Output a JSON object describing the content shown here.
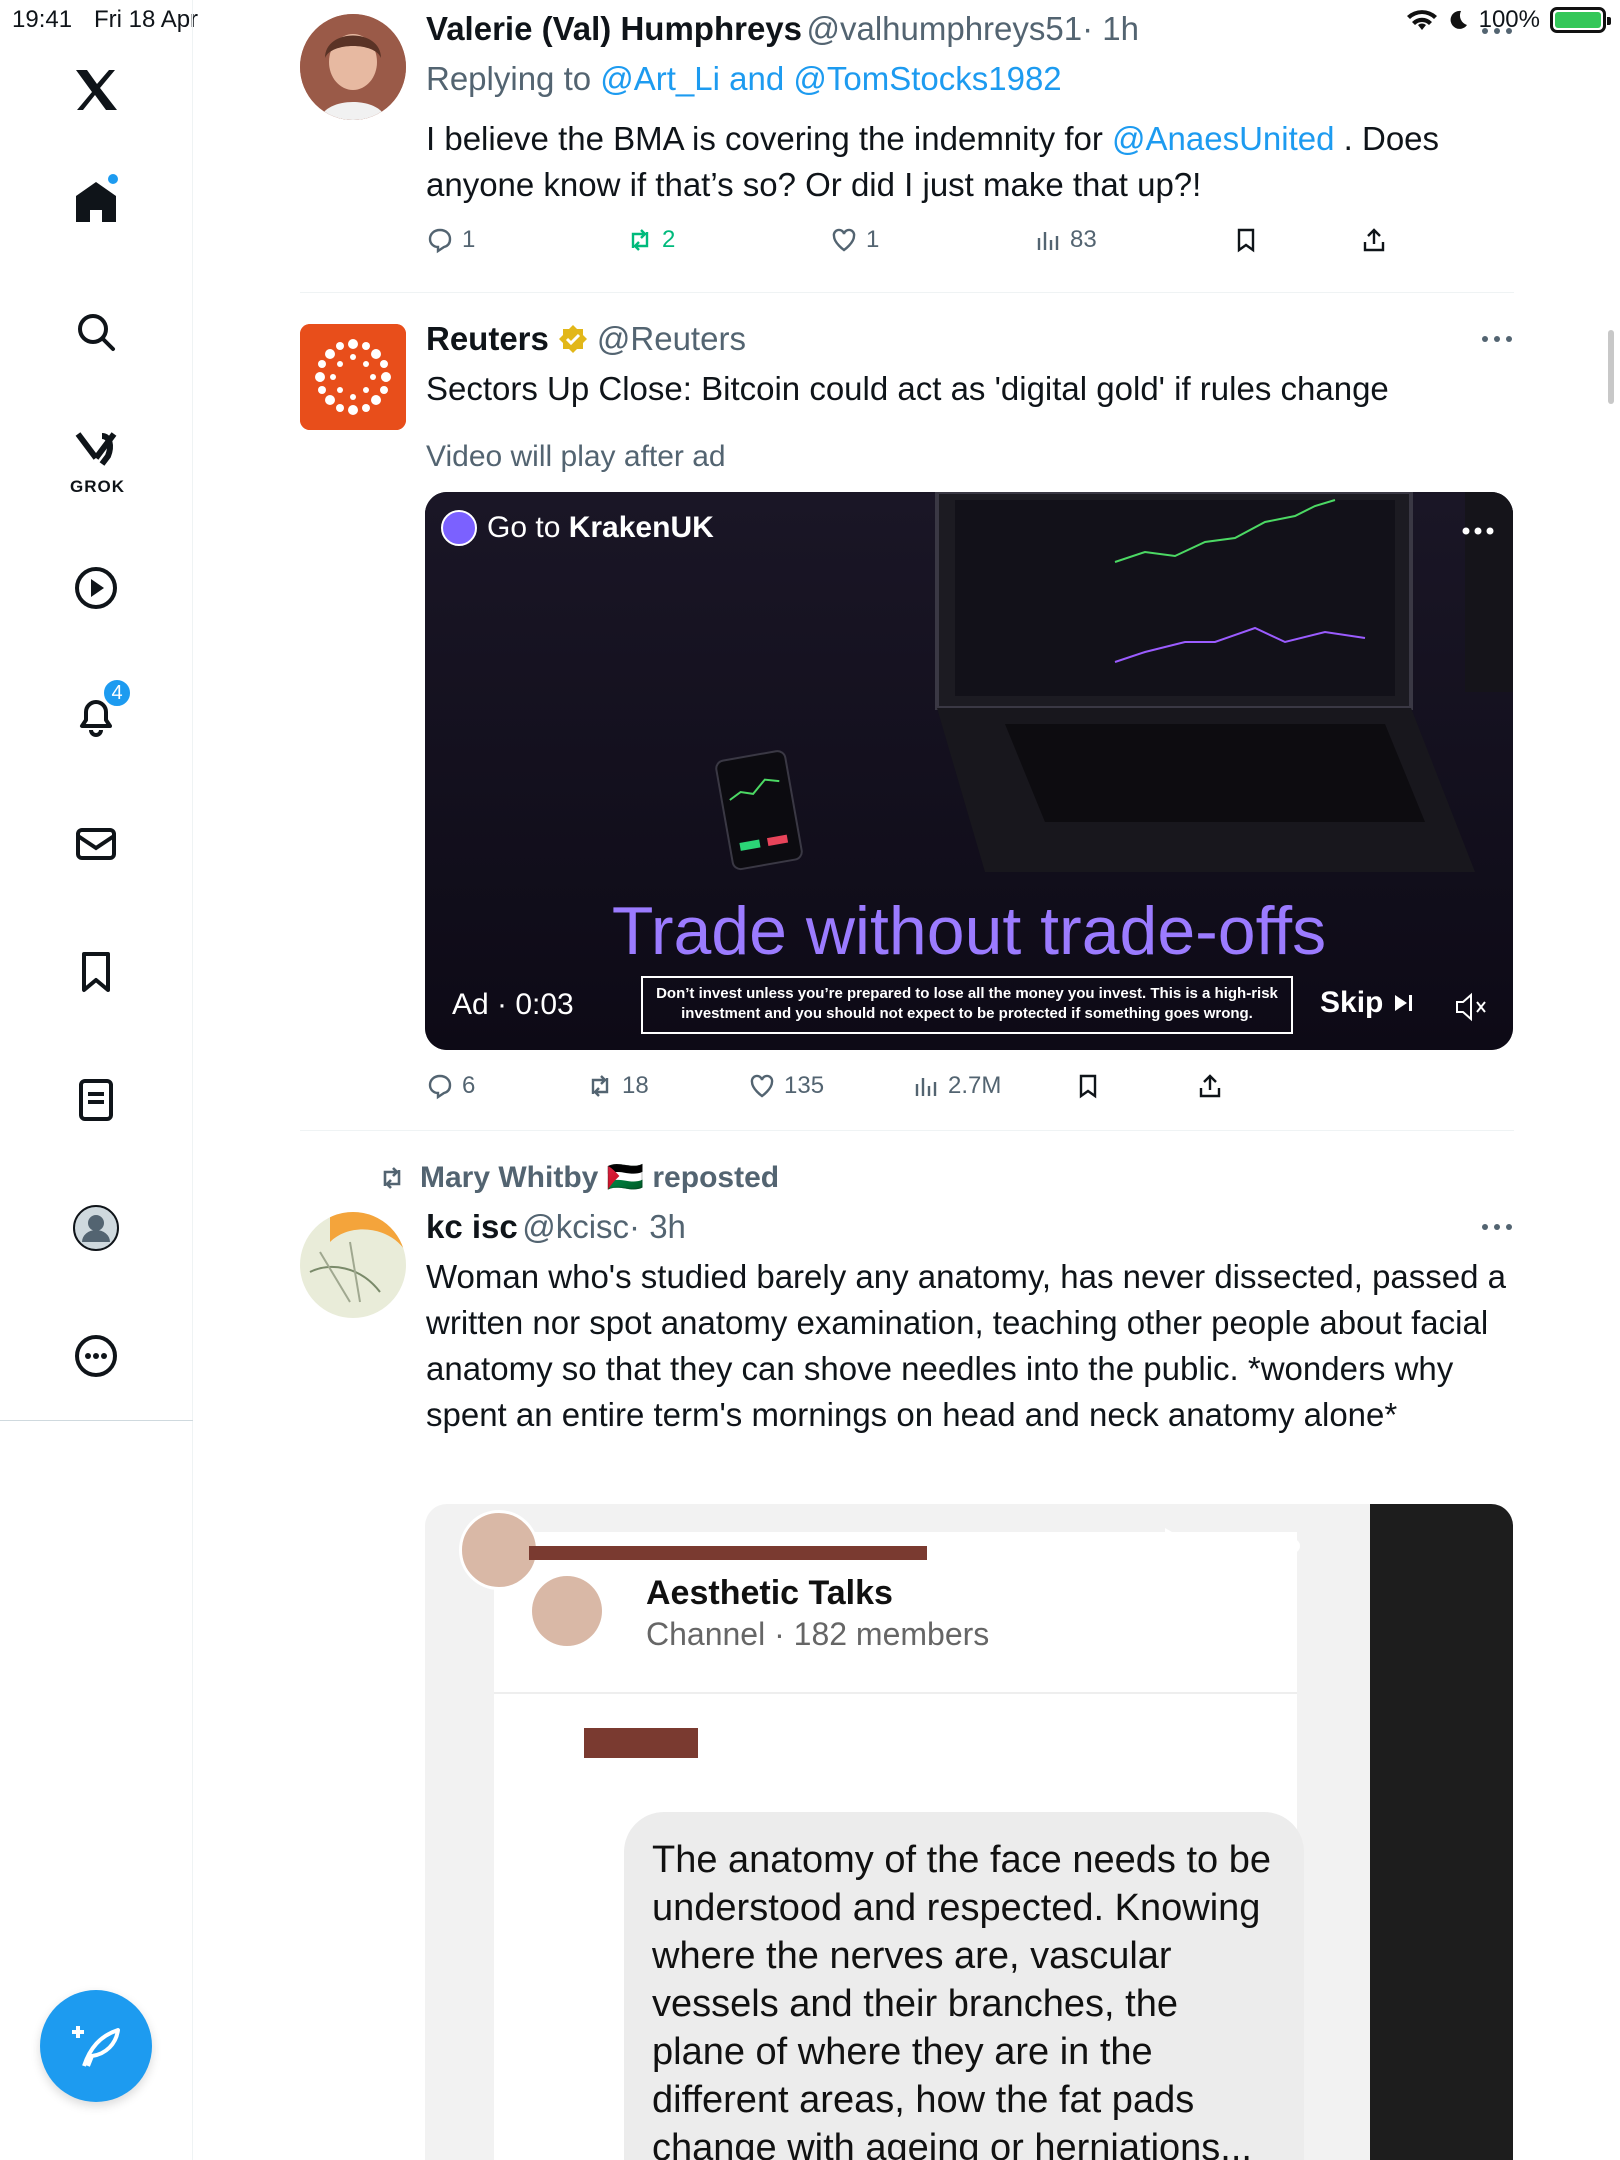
{
  "status_bar": {
    "time": "19:41",
    "date": "Fri 18 Apr",
    "battery": "100%"
  },
  "sidebar": {
    "grok_label": "GROK",
    "notification_count": "4",
    "icons": [
      "x-logo-icon",
      "home-icon",
      "search-icon",
      "grok-icon",
      "video-icon",
      "notifications-icon",
      "messages-icon",
      "bookmarks-icon",
      "lists-icon",
      "profile-icon",
      "more-icon"
    ]
  },
  "tweets": [
    {
      "name": "Valerie (Val) Humphreys",
      "handle": "@valhumphreys51",
      "time": "· 1h",
      "replying_prefix": "Replying to ",
      "replying_to": "@Art_Li and @TomStocks1982",
      "text_before": "I believe the BMA is covering the indemnity for ",
      "mention": "@AnaesUnited",
      "text_after": " . Does anyone know if that’s so? Or did I just make that up?!",
      "replies": "1",
      "reposts": "2",
      "likes": "1",
      "views": "83"
    },
    {
      "name": "Reuters",
      "handle": "@Reuters",
      "text": "Sectors Up Close: Bitcoin could act as 'digital gold' if rules change",
      "video_note": "Video will play after ad",
      "ad": {
        "go_to": "Go to ",
        "advertiser": "KrakenUK",
        "headline": "Trade without trade-offs",
        "disclaimer": "Don’t invest unless you’re prepared to lose all the money you invest. This is a high-risk investment and you should not expect to be protected if something goes wrong.",
        "ad_time": "Ad · 0:03",
        "skip": "Skip"
      },
      "replies": "6",
      "reposts": "18",
      "likes": "135",
      "views": "2.7M"
    },
    {
      "reposted_by": "Mary Whitby 🇵🇸",
      "reposted_label": " reposted",
      "name": "kc isc",
      "handle": "@kcisc",
      "time": "· 3h",
      "text": "Woman who's studied barely any anatomy, has never dissected, passed a written nor spot anatomy examination, teaching other people about facial anatomy so that they can shove needles into the public. *wonders why spent an entire term's mornings on head and neck anatomy alone*",
      "media": {
        "channel_name": "Aesthetic Talks",
        "channel_meta": "Channel · 182 members",
        "bubble_text": "The anatomy of the face needs to be understood and respected. Knowing where the nerves are, vascular vessels and their branches, the plane of where they are in the different areas, how the fat pads change with ageing or herniations... it's honestly endless!"
      }
    }
  ]
}
